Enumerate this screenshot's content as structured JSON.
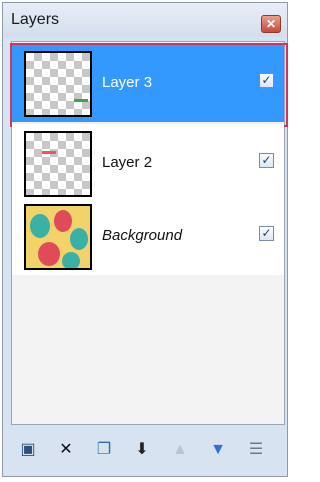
{
  "panel": {
    "title": "Layers",
    "close_glyph": "✕"
  },
  "layers": [
    {
      "name": "Layer 3",
      "visible": true,
      "selected": true,
      "italic": false,
      "check": "✓"
    },
    {
      "name": "Layer 2",
      "visible": true,
      "selected": false,
      "italic": false,
      "check": "✓"
    },
    {
      "name": "Background",
      "visible": true,
      "selected": false,
      "italic": true,
      "check": "✓"
    }
  ],
  "colors": {
    "selection": "#3399ff",
    "selection_outline": "#d0355f",
    "panel_bg": "#d8e3f1"
  },
  "toolbar": {
    "buttons": [
      {
        "name": "new-layer-icon",
        "glyph": "▣"
      },
      {
        "name": "delete-layer-icon",
        "glyph": "✕"
      },
      {
        "name": "duplicate-layer-icon",
        "glyph": "❐"
      },
      {
        "name": "merge-layer-icon",
        "glyph": "⬇"
      },
      {
        "name": "move-layer-up-icon",
        "glyph": "▲"
      },
      {
        "name": "move-layer-down-icon",
        "glyph": "▼"
      },
      {
        "name": "layer-properties-icon",
        "glyph": "☰"
      }
    ]
  }
}
